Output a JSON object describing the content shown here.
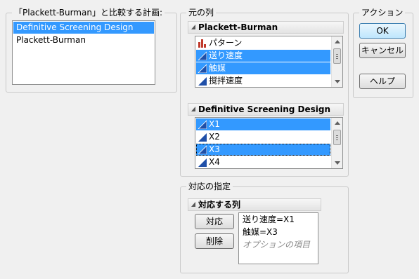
{
  "compare_group": {
    "title": "「Plackett-Burman」と比較する計画:",
    "items": [
      {
        "label": "Definitive Screening Design",
        "selected": true
      },
      {
        "label": "Plackett-Burman",
        "selected": false
      }
    ]
  },
  "source_group": {
    "title": "元の列",
    "panels": [
      {
        "header": "Plackett-Burman",
        "items": [
          {
            "label": "パターン",
            "icon": "bar-chart-icon",
            "selected": false
          },
          {
            "label": "送り速度",
            "icon": "continuous-icon",
            "selected": true
          },
          {
            "label": "触媒",
            "icon": "continuous-icon",
            "selected": true
          },
          {
            "label": "撹拌速度",
            "icon": "continuous-icon",
            "selected": false
          }
        ]
      },
      {
        "header": "Definitive Screening Design",
        "items": [
          {
            "label": "X1",
            "icon": "continuous-icon",
            "selected": true
          },
          {
            "label": "X2",
            "icon": "continuous-icon",
            "selected": false
          },
          {
            "label": "X3",
            "icon": "continuous-icon",
            "selected": true
          },
          {
            "label": "X4",
            "icon": "continuous-icon",
            "selected": false
          }
        ]
      }
    ]
  },
  "action_group": {
    "title": "アクション",
    "ok": "OK",
    "cancel": "キャンセル",
    "help": "ヘルプ"
  },
  "match_group": {
    "title": "対応の指定",
    "panel_header": "対応する列",
    "match_button": "対応",
    "remove_button": "削除",
    "pairs": [
      "送り速度=X1",
      "触媒=X3"
    ],
    "optional_hint": "オプションの項目"
  },
  "colors": {
    "selection": "#3399ff",
    "continuous_icon": "#1f4fa8",
    "bar_icon": "#c0392b"
  }
}
